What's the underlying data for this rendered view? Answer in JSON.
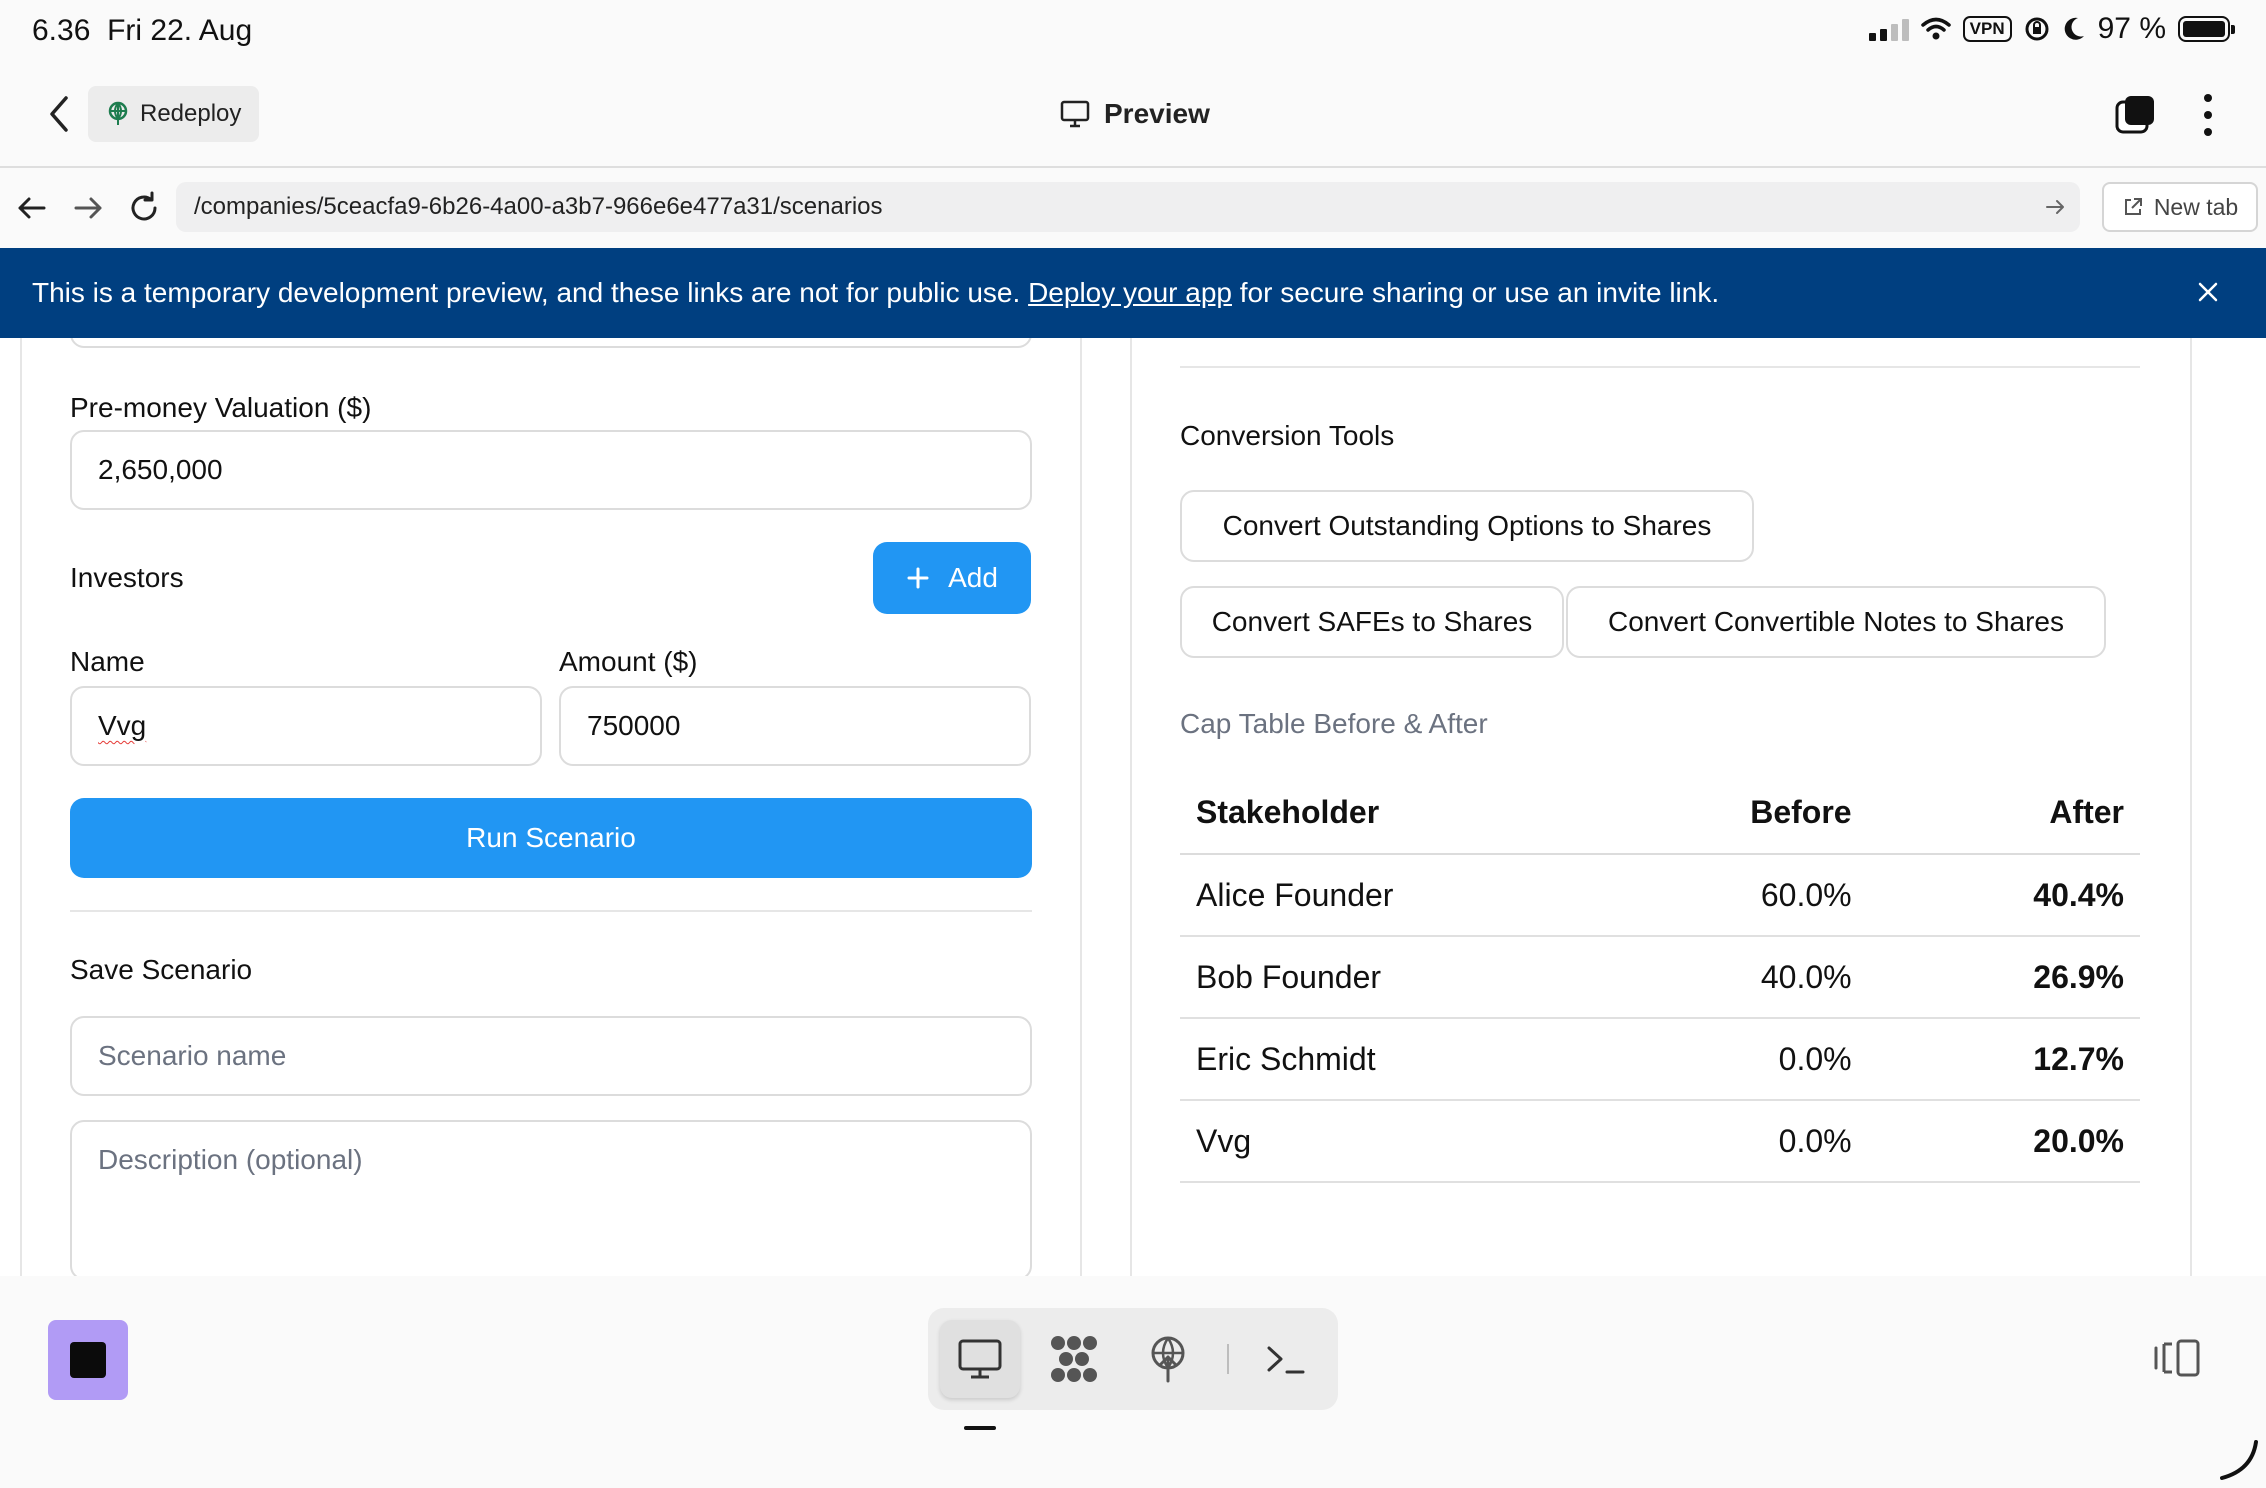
{
  "status": {
    "time": "6.36",
    "date": "Fri 22. Aug",
    "vpn": "VPN",
    "battery": "97 %"
  },
  "toolbar": {
    "redeploy_label": "Redeploy",
    "preview_label": "Preview"
  },
  "browser": {
    "url": "/companies/5ceacfa9-6b26-4a00-a3b7-966e6e477a31/scenarios",
    "new_tab_label": "New tab"
  },
  "banner": {
    "text_before": "This is a temporary development preview, and these links are not for public use.",
    "link": "Deploy your app",
    "text_after": "for secure sharing or use an invite link."
  },
  "scenario_form": {
    "valuation_label": "Pre-money Valuation ($)",
    "valuation_value": "2,650,000",
    "investors_label": "Investors",
    "add_label": "Add",
    "name_label": "Name",
    "amount_label": "Amount ($)",
    "investor_name": "Vvg",
    "investor_amount": "750000",
    "run_label": "Run Scenario",
    "save_heading": "Save Scenario",
    "scenario_name_placeholder": "Scenario name",
    "description_placeholder": "Description (optional)"
  },
  "conversion": {
    "heading": "Conversion Tools",
    "options_btn": "Convert Outstanding Options to Shares",
    "safes_btn": "Convert SAFEs to Shares",
    "notes_btn": "Convert Convertible Notes to Shares"
  },
  "cap_table": {
    "heading": "Cap Table Before & After",
    "columns": [
      "Stakeholder",
      "Before",
      "After"
    ],
    "rows": [
      {
        "name": "Alice Founder",
        "before": "60.0%",
        "after": "40.4%"
      },
      {
        "name": "Bob Founder",
        "before": "40.0%",
        "after": "26.9%"
      },
      {
        "name": "Eric Schmidt",
        "before": "0.0%",
        "after": "12.7%"
      },
      {
        "name": "Vvg",
        "before": "0.0%",
        "after": "20.0%"
      }
    ]
  },
  "colors": {
    "banner_bg": "#003f80",
    "primary": "#2196f3",
    "stop_button": "#b19bf5"
  },
  "icons": [
    "back-chevron-icon",
    "redeploy-icon",
    "monitor-icon",
    "tabs-icon",
    "more-vertical-icon",
    "arrow-left-icon",
    "arrow-right-icon",
    "reload-icon",
    "arrow-go-icon",
    "external-link-icon",
    "close-icon",
    "plus-icon",
    "stop-icon",
    "preview-icon",
    "grid-icon",
    "deploy-icon",
    "terminal-icon",
    "sidepanel-icon"
  ]
}
